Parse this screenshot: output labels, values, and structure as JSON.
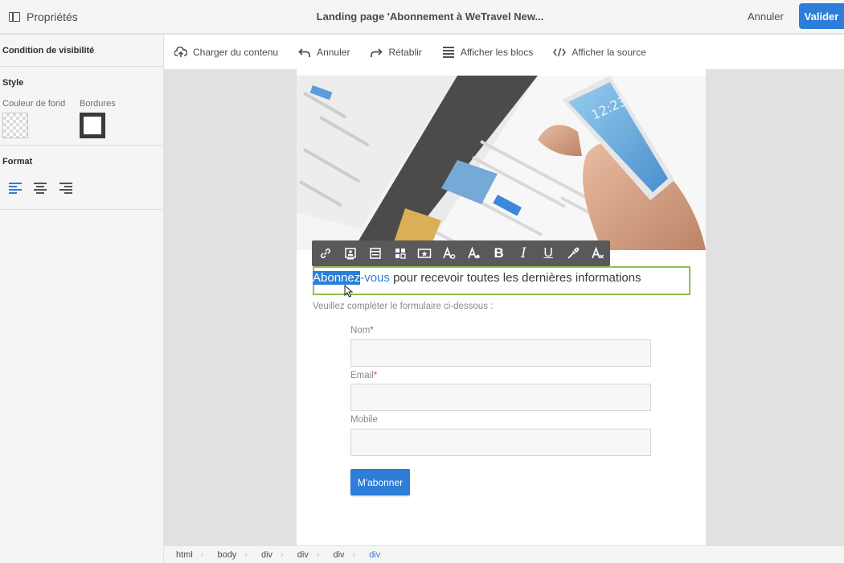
{
  "topbar": {
    "panel_label": "Propriétés",
    "title": "Landing page 'Abonnement à WeTravel New...",
    "cancel_label": "Annuler",
    "validate_label": "Valider"
  },
  "sidebar": {
    "visibility_title": "Condition de visibilité",
    "style_title": "Style",
    "bg_color_label": "Couleur de fond",
    "borders_label": "Bordures",
    "format_title": "Format"
  },
  "toolbar": {
    "items": [
      {
        "label": "Charger du contenu",
        "icon": "cloud-upload-icon"
      },
      {
        "label": "Annuler",
        "icon": "undo-icon"
      },
      {
        "label": "Rétablir",
        "icon": "redo-icon"
      },
      {
        "label": "Afficher les blocs",
        "icon": "blocks-icon"
      },
      {
        "label": "Afficher la source",
        "icon": "code-icon"
      }
    ]
  },
  "content": {
    "headline_selected": "Abonnez",
    "headline_link": "-vous",
    "headline_rest": " pour recevoir toutes les dernières informations",
    "subtext": "Veuillez compléter le formulaire ci-dessous :",
    "fields": [
      {
        "label": "Nom",
        "required": "*"
      },
      {
        "label": "Email",
        "required": "*"
      },
      {
        "label": "Mobile",
        "required": ""
      }
    ],
    "submit_label": "M'abonner"
  },
  "breadcrumb": [
    "html",
    "body",
    "div",
    "div",
    "div",
    "div"
  ],
  "colors": {
    "accent": "#2d7ed8",
    "selection_border": "#8dc252",
    "required": "#e64141"
  }
}
